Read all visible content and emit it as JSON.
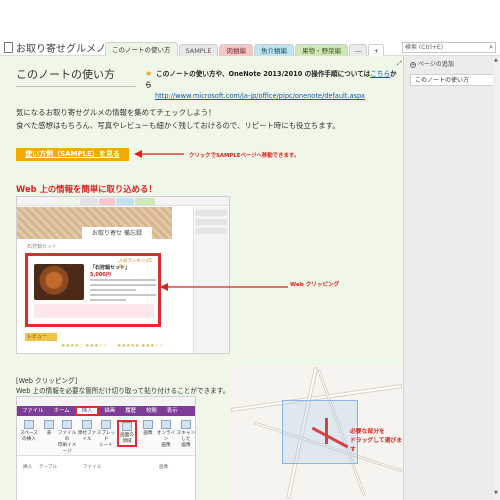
{
  "notebook": {
    "title": "お取り寄せグルメノート"
  },
  "tabs": [
    {
      "label": "このノートの使い方"
    },
    {
      "label": "SAMPLE"
    },
    {
      "label": "肉類編"
    },
    {
      "label": "魚介類編"
    },
    {
      "label": "果物・野菜編"
    },
    {
      "label": "—"
    },
    {
      "label": "+"
    }
  ],
  "search": {
    "placeholder": "検索 (Ctrl+E)",
    "icon": "search-icon"
  },
  "page": {
    "title": "このノートの使い方",
    "note_lead": "このノートの使い方や、OneNote 2013/2010 の操作手順については",
    "note_link": "こちら",
    "note_tail": "から",
    "note_url": "http://www.microsoft.com/ja-jp/office/pipc/onenote/default.aspx",
    "intro_line1": "気になるお取り寄せグルメの情報を集めてチェックしよう！",
    "intro_line2": "食べた感想はもちろん、写真やレビューも細かく残しておけるので、リピート時にも役立ちます。",
    "usage_link": "使い方例（SAMPLE）を見る",
    "usage_note": "クリックでSAMPLEページへ移動できます。",
    "web_heading": "Web 上の情報を簡単に取り込める！",
    "shot1": {
      "banner": "お取り寄せ 備忘録",
      "label": "石狩鍋セット",
      "product_title": "「石狩鍋セット」",
      "price": "5,000円",
      "badge": "人気ランキング1位！",
      "review": "レビュー"
    },
    "web_clipping_note": "Web クリッピング",
    "wc_head_line1": "[Web クリッピング]",
    "wc_head_line2": "Web 上の情報を必要な箇所だけ切り取って貼り付けることができます。",
    "ribbon": {
      "tabs": [
        "ファイル",
        "ホーム",
        "挿入",
        "描画",
        "履歴",
        "校閲",
        "表示"
      ],
      "buttons": [
        {
          "label": "スペース\nの挿入"
        },
        {
          "label": "表"
        },
        {
          "label": "ファイルの\n印刷イメージ"
        },
        {
          "label": "添付ファイル"
        },
        {
          "label": "スプレッド\nシート"
        },
        {
          "label": "画面の\n領域"
        },
        {
          "label": "画像"
        },
        {
          "label": "オンライン\n画像"
        },
        {
          "label": "スキャンした\n画像"
        }
      ],
      "groups": [
        "挿入",
        "テーブル",
        "ファイル",
        "画像"
      ]
    },
    "map_note_line1": "必要な部分を",
    "map_note_line2": "ドラッグして選びます"
  },
  "right_pane": {
    "add_page": "ページの追加",
    "page_item": "このノートの使い方"
  },
  "colors": {
    "accent_red": "#e02020",
    "link_blue": "#0b55c4",
    "page_bg": "#eef7e8",
    "button_orange": "#f2a900"
  }
}
